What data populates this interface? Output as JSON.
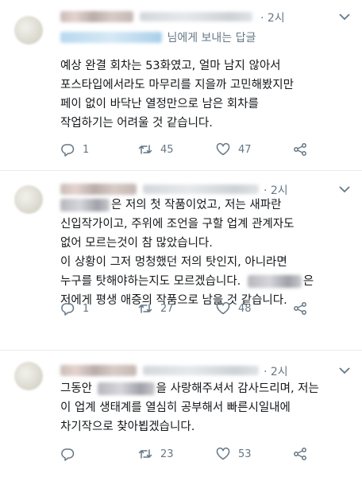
{
  "tweets": [
    {
      "time": "· 2시",
      "reply_suffix": "님에게 보내는 답글",
      "lines": [
        "예상 완결 회차는 53화였고, 얼마 남지 않아서",
        "포스타입에서라도 마무리를 지을까 고민해봤지만",
        "페이 없이 바닥난 열정만으로 남은 회차를",
        "작업하기는 어려울 것 같습니다."
      ],
      "reply_count": "1",
      "retweet_count": "45",
      "like_count": "47"
    },
    {
      "time": "· 2시",
      "lines_before": [
        "은 저의 첫 작품이었고, 저는 새파란"
      ],
      "lines": [
        "신입작가이고, 주위에 조언을 구할 업계 관계자도",
        "없어 모르는것이 참 많았습니다.",
        "이 상황이 그저 멍청했던 저의 탓인지, 아니라면",
        "누구를 탓해야하는지도 모르겠습니다."
      ],
      "line6_suffix": "은",
      "line7": "저에게 평생 애증의 작품으로 남을 것 같습니다.",
      "reply_count": "1",
      "retweet_count": "27",
      "like_count": "48"
    },
    {
      "time": "· 2시",
      "line1_prefix": "그동안",
      "line1_suffix": "을 사랑해주셔서 감사드리며, 저는",
      "lines": [
        "이 업계 생태계를 열심히 공부해서 빠른시일내에",
        "차기작으로 찾아뵙겠습니다."
      ],
      "reply_count": "",
      "retweet_count": "23",
      "like_count": "53"
    }
  ],
  "icons": {
    "reply": "reply-icon",
    "retweet": "retweet-icon",
    "like": "heart-icon",
    "share": "share-icon",
    "caret": "chevron-down-icon"
  },
  "colors": {
    "text": "#14171a",
    "secondary": "#657786",
    "icon": "#657786",
    "divider": "#e6ecf0"
  }
}
